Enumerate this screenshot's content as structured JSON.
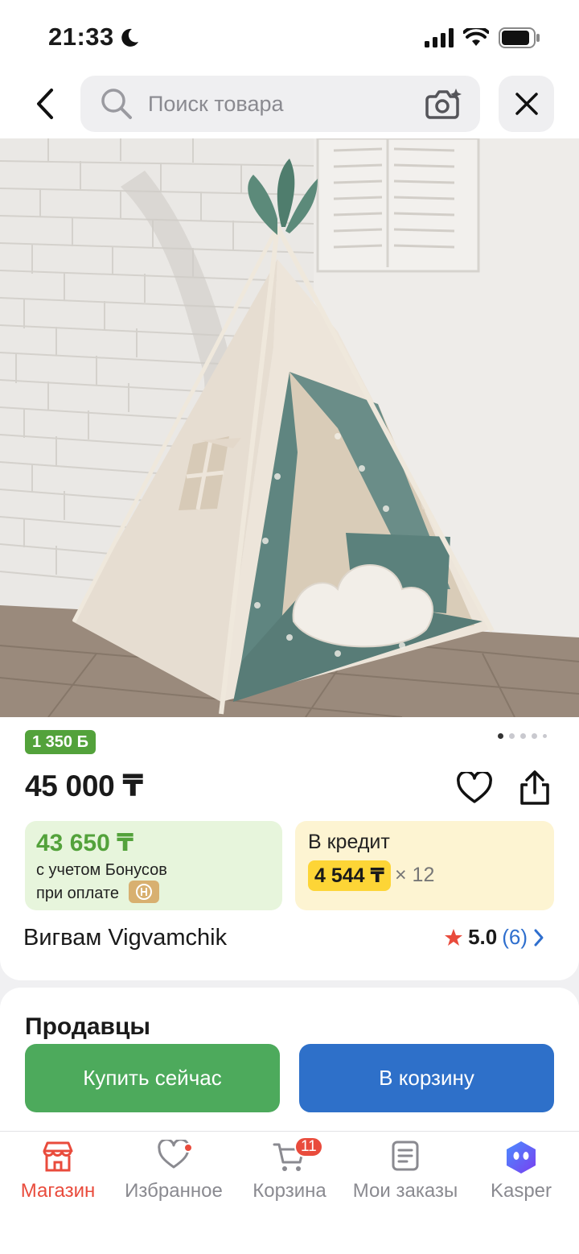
{
  "status_bar": {
    "time": "21:33"
  },
  "search": {
    "placeholder": "Поиск товара"
  },
  "product": {
    "bonus_badge": "1 350 Б",
    "price": "45 000 ₸",
    "bonus_offer": {
      "price": "43 650 ₸",
      "line1": "с учетом Бонусов",
      "line2": "при оплате"
    },
    "credit": {
      "label": "В кредит",
      "monthly": "4 544 ₸",
      "multiplier": "× 12"
    },
    "title": "Вигвам Vigvamchik",
    "rating": {
      "value": "5.0",
      "count": "(6)"
    },
    "gallery": {
      "current": 1,
      "total": 5
    }
  },
  "sellers": {
    "title": "Продавцы"
  },
  "actions": {
    "buy_now": "Купить сейчас",
    "add_to_cart": "В корзину"
  },
  "bottom_nav": {
    "items": [
      {
        "label": "Магазин",
        "icon": "store-icon",
        "active": true
      },
      {
        "label": "Избранное",
        "icon": "heart-icon",
        "active": false
      },
      {
        "label": "Корзина",
        "icon": "cart-icon",
        "badge": "11",
        "active": false
      },
      {
        "label": "Мои заказы",
        "icon": "orders-icon",
        "active": false
      },
      {
        "label": "Kasper",
        "icon": "kasper-assistant-icon",
        "active": false
      }
    ]
  },
  "colors": {
    "accent_red": "#e94b3c",
    "bonus_green": "#53a23b",
    "buy_green": "#4daa5c",
    "cart_blue": "#2e70c9",
    "credit_yellow": "#fdd536"
  }
}
